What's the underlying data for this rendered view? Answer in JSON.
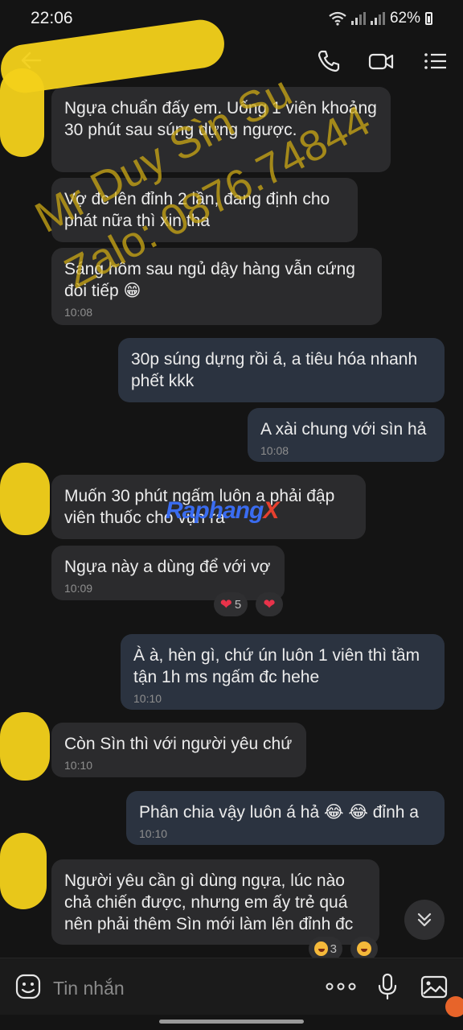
{
  "status": {
    "time": "22:06",
    "battery": "62%"
  },
  "header": {
    "back_icon": "back-arrow-icon",
    "call_icon": "phone-icon",
    "video_icon": "video-camera-icon",
    "menu_icon": "list-menu-icon"
  },
  "messages": [
    {
      "dir": "in",
      "text": "Ngựa chuẩn đấy em. Uống 1 viên khoảng 30 phút sau súng dựng ngược."
    },
    {
      "dir": "in",
      "text": "Vợ đc lên đỉnh 2 lần, đang định cho phát nữa thì xin tha"
    },
    {
      "dir": "in",
      "text": "Sáng hôm sau ngủ dậy hàng vẫn cứng đòi tiếp 😁",
      "time": "10:08"
    },
    {
      "dir": "out",
      "text": "30p súng dựng rồi á, a tiêu hóa nhanh phết kkk"
    },
    {
      "dir": "out",
      "text": "A xài chung với sìn hả",
      "time": "10:08"
    },
    {
      "dir": "in",
      "text": "Muốn 30 phút ngấm luôn a phải đập viên thuốc cho vụn ra"
    },
    {
      "dir": "in",
      "text": "Ngựa này a dùng để với vợ",
      "time": "10:09"
    },
    {
      "dir": "out",
      "text": "À à, hèn gì, chứ ún luôn 1 viên thì tầm tận 1h ms ngấm đc hehe",
      "time": "10:10"
    },
    {
      "dir": "in",
      "text": "Còn Sìn thì với người yêu chứ",
      "time": "10:10"
    },
    {
      "dir": "out",
      "text": "Phân chia vậy luôn á hả 😂 😂 đỉnh a",
      "time": "10:10"
    },
    {
      "dir": "in",
      "text": "Người yêu cần gì dùng ngựa, lúc nào chả chiến được, nhưng em ấy trẻ quá nên phải thêm Sìn mới làm lên đỉnh đc"
    }
  ],
  "reactions": {
    "msg7_count": "5",
    "msg11_count": "3",
    "heart_color": "#e8334a"
  },
  "watermark": {
    "line1": "Mr Duy Sìn Su",
    "line2": "Zalo: 0876.74844",
    "brand_a": "Raphang",
    "brand_b": "X"
  },
  "composer": {
    "placeholder": "Tin nhắn",
    "emoji_icon": "sticker-icon",
    "more_icon": "more-dots-icon",
    "mic_icon": "microphone-icon",
    "image_icon": "image-icon"
  },
  "colors": {
    "background": "#141414",
    "incoming": "#2b2b2d",
    "outgoing": "#2b3340"
  }
}
